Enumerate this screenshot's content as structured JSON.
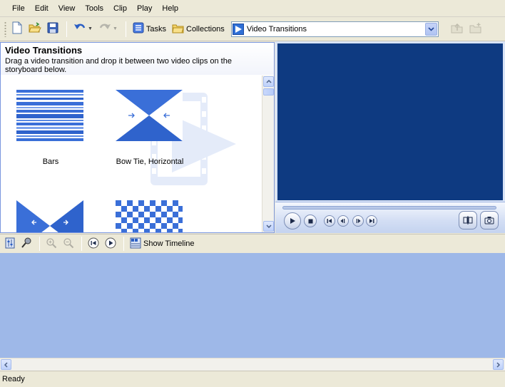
{
  "menu": {
    "items": [
      {
        "label": "File"
      },
      {
        "label": "Edit"
      },
      {
        "label": "View"
      },
      {
        "label": "Tools"
      },
      {
        "label": "Clip"
      },
      {
        "label": "Play"
      },
      {
        "label": "Help"
      }
    ]
  },
  "toolbar": {
    "tasks_label": "Tasks",
    "collections_label": "Collections",
    "collection_combo_value": "Video Transitions"
  },
  "pane": {
    "title": "Video Transitions",
    "description": "Drag a video transition and drop it between two video clips on the storyboard below."
  },
  "transitions": [
    {
      "label": "Bars",
      "icon": "bars-transition-icon"
    },
    {
      "label": "Bow Tie, Horizontal",
      "icon": "bow-tie-horizontal-icon"
    },
    {
      "label": "",
      "icon": "bow-tie-vertical-icon"
    },
    {
      "label": "",
      "icon": "checkerboard-icon"
    }
  ],
  "storyboard_toolbar": {
    "show_timeline_label": "Show Timeline"
  },
  "status": {
    "text": "Ready"
  },
  "colors": {
    "accent_blue": "#3a6fd8",
    "monitor_screen": "#0e3a81",
    "storyboard_bg": "#9eb8e8"
  }
}
